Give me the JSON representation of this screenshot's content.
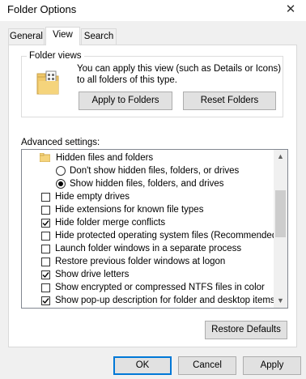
{
  "window": {
    "title": "Folder Options",
    "close_glyph": "✕"
  },
  "tabs": [
    {
      "label": "General",
      "active": false
    },
    {
      "label": "View",
      "active": true
    },
    {
      "label": "Search",
      "active": false
    }
  ],
  "folder_views": {
    "group_label": "Folder views",
    "description": "You can apply this view (such as Details or Icons) to all folders of this type.",
    "icon": "folder-views-icon",
    "apply_label": "Apply to Folders",
    "reset_label": "Reset Folders"
  },
  "advanced": {
    "label": "Advanced settings:",
    "items": [
      {
        "kind": "folder",
        "label": "Hidden files and folders",
        "icon": "folder-icon"
      },
      {
        "kind": "radio",
        "label": "Don't show hidden files, folders, or drives",
        "checked": false
      },
      {
        "kind": "radio",
        "label": "Show hidden files, folders, and drives",
        "checked": true
      },
      {
        "kind": "checkbox",
        "label": "Hide empty drives",
        "checked": false
      },
      {
        "kind": "checkbox",
        "label": "Hide extensions for known file types",
        "checked": false
      },
      {
        "kind": "checkbox",
        "label": "Hide folder merge conflicts",
        "checked": true
      },
      {
        "kind": "checkbox",
        "label": "Hide protected operating system files (Recommended)",
        "checked": false
      },
      {
        "kind": "checkbox",
        "label": "Launch folder windows in a separate process",
        "checked": false
      },
      {
        "kind": "checkbox",
        "label": "Restore previous folder windows at logon",
        "checked": false
      },
      {
        "kind": "checkbox",
        "label": "Show drive letters",
        "checked": true
      },
      {
        "kind": "checkbox",
        "label": "Show encrypted or compressed NTFS files in color",
        "checked": false
      },
      {
        "kind": "checkbox",
        "label": "Show pop-up description for folder and desktop items",
        "checked": true
      }
    ],
    "scroll_up_glyph": "▲",
    "scroll_down_glyph": "▼"
  },
  "restore_defaults_label": "Restore Defaults",
  "footer": {
    "ok_label": "OK",
    "cancel_label": "Cancel",
    "apply_label": "Apply"
  },
  "colors": {
    "accent": "#0078d7",
    "folder": "#f5d47c"
  }
}
